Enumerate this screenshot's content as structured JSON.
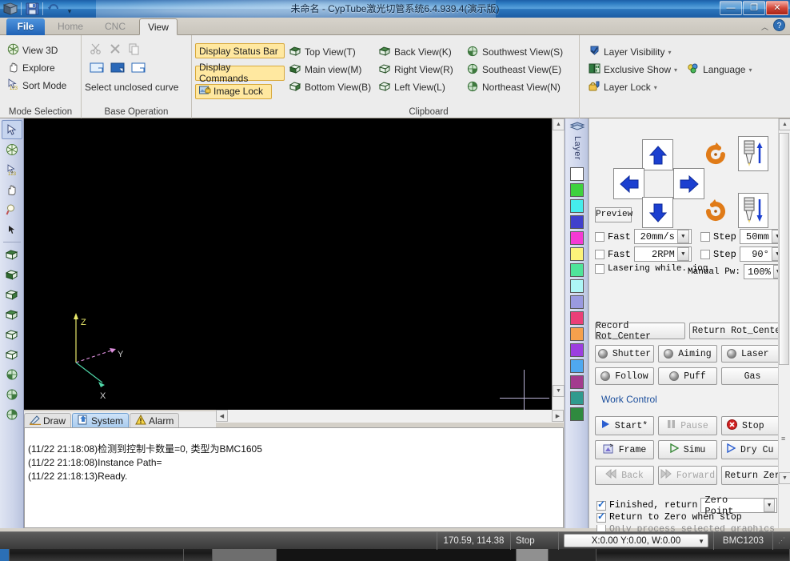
{
  "window": {
    "title": "未命名 - CypTube激光切管系统6.4.939.4(演示版)",
    "minimize_label": "—",
    "maximize_label": "❐",
    "close_label": "✕"
  },
  "quick_access": {
    "app_icon": "app-logo-icon",
    "save_icon": "save-icon",
    "undo_icon": "undo-icon",
    "dropdown_glyph": "▾"
  },
  "ribbon": {
    "tabs": [
      {
        "id": "file",
        "label": "File"
      },
      {
        "id": "home",
        "label": "Home"
      },
      {
        "id": "cnc",
        "label": "CNC"
      },
      {
        "id": "view",
        "label": "View"
      }
    ],
    "active_tab": "View",
    "collapse_glyph": "︿",
    "help_glyph": "?",
    "groups": [
      {
        "id": "mode-selection",
        "label": "Mode Selection",
        "items": [
          {
            "label": "View 3D",
            "icon": "view-3d-icon"
          },
          {
            "label": "Explore",
            "icon": "hand-explore-icon"
          },
          {
            "label": "Sort Mode",
            "icon": "sort-mode-icon"
          }
        ]
      },
      {
        "id": "base-operation",
        "label": "Base Operation",
        "items": [
          {
            "label": "Select unclosed curve",
            "icon": "select-unclosed-curve-icon"
          }
        ],
        "top_icons": [
          "cut-icon",
          "delete-icon",
          "copy-icon"
        ],
        "mid_icons": [
          "select-all-icon",
          "select-inverse-icon",
          "select-none-icon"
        ]
      },
      {
        "id": "display-toggles",
        "label": "",
        "items": [
          {
            "label": "Display Status Bar",
            "icon": ""
          },
          {
            "label": "Display Commands",
            "icon": ""
          },
          {
            "label": "Image Lock",
            "icon": "image-lock-icon"
          }
        ]
      },
      {
        "id": "clipboard",
        "label": "Clipboard",
        "col1": [
          {
            "label": "Top View(T)",
            "icon": "top-view-icon"
          },
          {
            "label": "Main view(M)",
            "icon": "main-view-icon"
          },
          {
            "label": "Bottom View(B)",
            "icon": "bottom-view-icon"
          }
        ],
        "col2": [
          {
            "label": "Back View(K)",
            "icon": "back-view-icon"
          },
          {
            "label": "Right View(R)",
            "icon": "right-view-icon"
          },
          {
            "label": "Left View(L)",
            "icon": "left-view-icon"
          }
        ],
        "col3": [
          {
            "label": "Southwest View(S)",
            "icon": "southwest-view-icon"
          },
          {
            "label": "Southeast View(E)",
            "icon": "southeast-view-icon"
          },
          {
            "label": "Northeast View(N)",
            "icon": "northeast-view-icon"
          }
        ]
      },
      {
        "id": "layers",
        "label": "",
        "items": [
          {
            "label": "Layer Visibility",
            "icon": "layer-visibility-icon",
            "caret": "▾"
          },
          {
            "label": "Exclusive Show",
            "icon": "exclusive-show-icon",
            "caret": "▾"
          },
          {
            "label": "Layer Lock",
            "icon": "layer-lock-icon",
            "caret": "▾"
          },
          {
            "label": "Language",
            "icon": "language-icon",
            "caret": "▾"
          }
        ]
      }
    ]
  },
  "left_toolbar": {
    "items": [
      {
        "icon": "pointer-select-icon",
        "selected": true
      },
      {
        "icon": "view-3d-icon",
        "selected": false
      },
      {
        "icon": "sort-mode-icon",
        "selected": false
      },
      {
        "icon": "hand-pan-icon",
        "selected": false
      },
      {
        "icon": "zoom-icon",
        "selected": false
      },
      {
        "icon": "small-pointer-icon",
        "selected": false
      },
      {
        "icon": "top-view-icon",
        "selected": false
      },
      {
        "icon": "main-view-icon",
        "selected": false
      },
      {
        "icon": "bottom-view-icon",
        "selected": false
      },
      {
        "icon": "back-view-icon",
        "selected": false
      },
      {
        "icon": "right-view-icon",
        "selected": false
      },
      {
        "icon": "left-view-icon",
        "selected": false
      },
      {
        "icon": "southwest-view-icon",
        "selected": false
      },
      {
        "icon": "southeast-view-icon",
        "selected": false
      },
      {
        "icon": "northeast-view-icon",
        "selected": false
      }
    ]
  },
  "viewport": {
    "background_color": "#000000",
    "axes": {
      "z_label": "Z",
      "z_color": "#e8e86a",
      "y_label": "Y",
      "y_color": "#dd8fdd",
      "x_label": "X",
      "x_color": "#4fd6a8"
    },
    "crosshair_color": "#b9b2d6"
  },
  "layer_panel": {
    "title": "Layer",
    "icon": "layers-stack-icon",
    "swatches": [
      "#ffffff",
      "#3fd13f",
      "#45ecec",
      "#4040cc",
      "#f53ad4",
      "#fcf37a",
      "#4fe49a",
      "#adf6f6",
      "#9a9ae0",
      "#ea3f78",
      "#f5a04d",
      "#9c3fe0",
      "#4fa8f0",
      "#a33b8e",
      "#2f9a8e",
      "#2f8a3f"
    ]
  },
  "log_panel": {
    "tabs": [
      {
        "label": "Draw",
        "icon": "draw-icon",
        "active": false
      },
      {
        "label": "System",
        "icon": "system-icon",
        "active": true
      },
      {
        "label": "Alarm",
        "icon": "alarm-icon",
        "active": false
      }
    ],
    "lines": [
      "(11/22 21:18:08)检测到控制卡数量=0, 类型为BMC1605",
      "(11/22 21:18:08)Instance Path=",
      "(11/22 21:18:13)Ready."
    ]
  },
  "control_panel": {
    "jog": {
      "up_icon": "arrow-up-icon",
      "down_icon": "arrow-down-icon",
      "left_icon": "arrow-left-icon",
      "right_icon": "arrow-right-icon",
      "rotate_ccw_icon": "rotate-ccw-icon",
      "rotate_cw_icon": "rotate-cw-icon",
      "z_up_icon": "nozzle-up-icon",
      "z_down_icon": "nozzle-down-icon",
      "preview_label": "Preview"
    },
    "speed_rows": [
      {
        "check_label": "Fast",
        "checked": false,
        "value": "20mm/s",
        "step_label": "Step",
        "step_checked": false,
        "step_value": "50mm"
      },
      {
        "check_label": "Fast",
        "checked": false,
        "value": "2RPM",
        "step_label": "Step",
        "step_checked": false,
        "step_value": "90°"
      }
    ],
    "lasering_row": {
      "check_label": "Lasering while..jog",
      "checked": false,
      "manual_label": "Manual Pw:",
      "manual_value": "100%"
    },
    "rot_center": [
      {
        "label": "Record Rot_Center"
      },
      {
        "label": "Return Rot_Cente"
      }
    ],
    "toggles": [
      {
        "label": "Shutter",
        "led": true
      },
      {
        "label": "Aiming",
        "led": true
      },
      {
        "label": "Laser",
        "led": true
      },
      {
        "label": "Follow",
        "led": true
      },
      {
        "label": "Puff",
        "led": true
      },
      {
        "label": "Gas",
        "led": false
      }
    ],
    "work_control_title": "Work Control",
    "work_buttons": [
      {
        "label": "Start*",
        "icon": "play-icon",
        "disabled": false
      },
      {
        "label": "Pause",
        "icon": "pause-icon",
        "disabled": true
      },
      {
        "label": "Stop",
        "icon": "stop-icon",
        "disabled": false
      },
      {
        "label": "Frame",
        "icon": "frame-icon",
        "disabled": false
      },
      {
        "label": "Simu",
        "icon": "simulate-icon",
        "disabled": false
      },
      {
        "label": "Dry Cu",
        "icon": "dry-cut-icon",
        "disabled": false
      },
      {
        "label": "Back",
        "icon": "back-icon",
        "disabled": true
      },
      {
        "label": "Forward",
        "icon": "forward-icon",
        "disabled": true
      },
      {
        "label": "Return Zer",
        "icon": "",
        "disabled": false
      }
    ],
    "options": [
      {
        "label": "Finished, return",
        "checked": true,
        "combo": "Zero Point"
      },
      {
        "label": "Return to Zero when stop",
        "checked": true,
        "combo": ""
      },
      {
        "label": "Only process selected graphics",
        "checked": false,
        "combo": ""
      }
    ]
  },
  "status_bar": {
    "coordinates": "170.59, 114.38",
    "state": "Stop",
    "position_combo": "X:0.00 Y:0.00, W:0.00",
    "controller": "BMC1203"
  }
}
